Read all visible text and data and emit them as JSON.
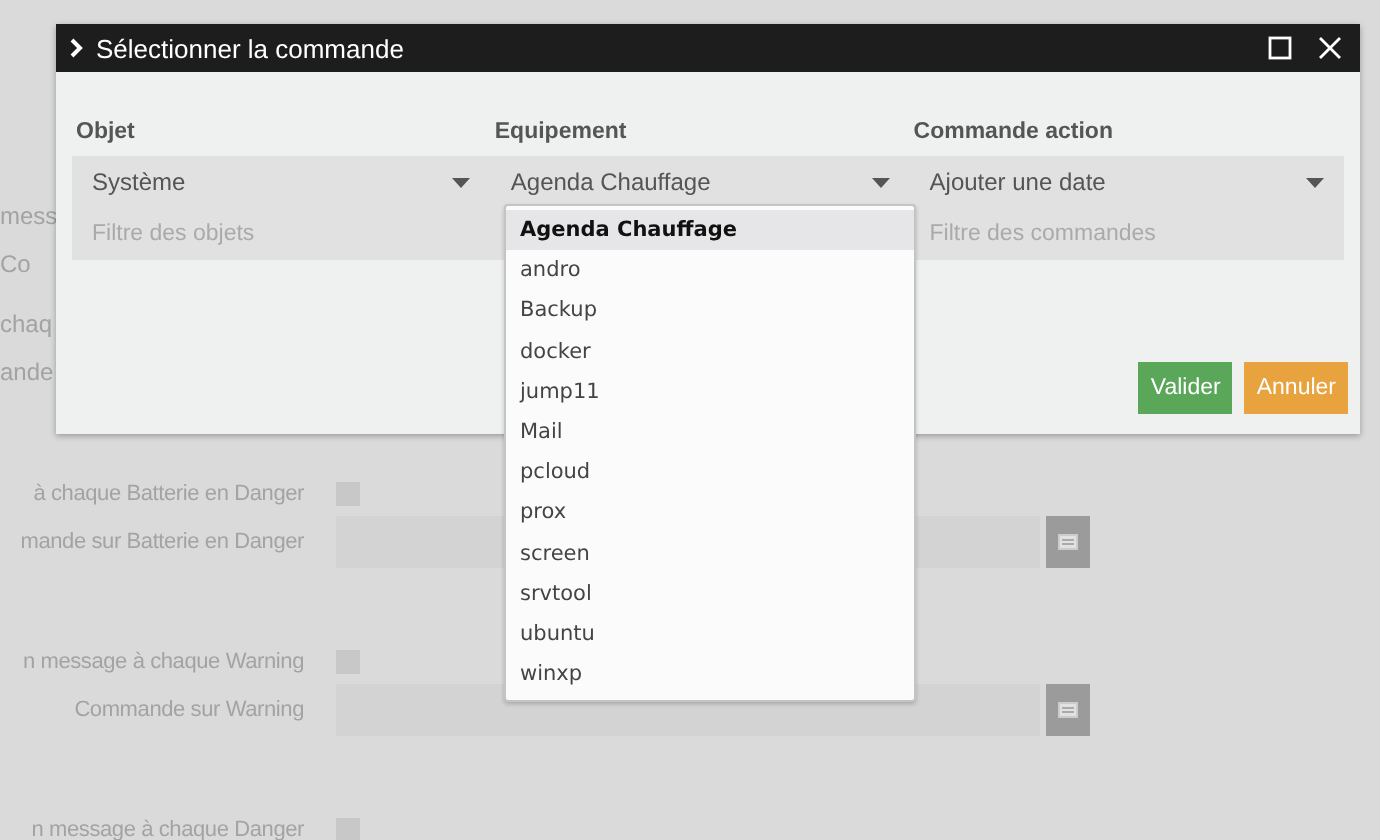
{
  "background": {
    "fragments": [
      "mess",
      "Co",
      "chaq",
      "ande"
    ],
    "groups": [
      {
        "rows": [
          {
            "label": "à chaque Batterie en Danger",
            "kind": "checkbox",
            "checked": false
          },
          {
            "label": "mande sur Batterie en Danger",
            "kind": "input"
          }
        ]
      },
      {
        "rows": [
          {
            "label": "n message à chaque Warning",
            "kind": "checkbox",
            "checked": false
          },
          {
            "label": "Commande sur Warning",
            "kind": "input"
          }
        ]
      },
      {
        "rows": [
          {
            "label": "n message à chaque Danger",
            "kind": "checkbox",
            "checked": false
          }
        ]
      }
    ]
  },
  "dialog": {
    "title": "Sélectionner la commande",
    "columns": [
      {
        "label": "Objet",
        "value": "Système",
        "filter_placeholder": "Filtre des objets"
      },
      {
        "label": "Equipement",
        "value": "Agenda Chauffage"
      },
      {
        "label": "Commande action",
        "value": "Ajouter une date",
        "filter_placeholder": "Filtre des commandes"
      }
    ],
    "dropdown": [
      {
        "label": "Agenda Chauffage",
        "selected": true
      },
      {
        "label": "andro",
        "selected": false
      },
      {
        "label": "Backup",
        "selected": false
      },
      {
        "label": "docker",
        "selected": false
      },
      {
        "label": "jump11",
        "selected": false
      },
      {
        "label": "Mail",
        "selected": false
      },
      {
        "label": "pcloud",
        "selected": false
      },
      {
        "label": "prox",
        "selected": false
      },
      {
        "label": "screen",
        "selected": false
      },
      {
        "label": "srvtool",
        "selected": false
      },
      {
        "label": "ubuntu",
        "selected": false
      },
      {
        "label": "winxp",
        "selected": false
      }
    ],
    "buttons": [
      {
        "label": "Valider",
        "kind": "primary"
      },
      {
        "label": "Annuler",
        "kind": "cancel"
      }
    ]
  }
}
